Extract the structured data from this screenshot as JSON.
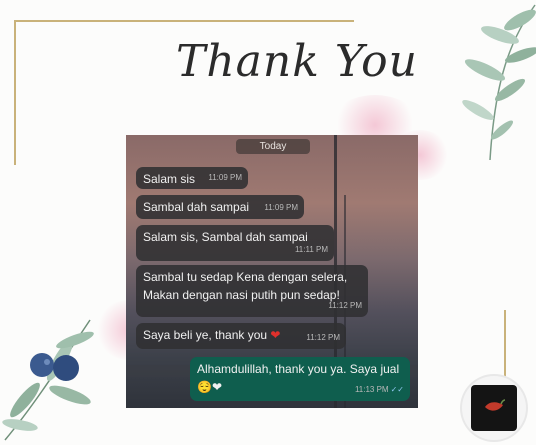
{
  "title": "Thank You",
  "chat": {
    "date_divider": "Today",
    "messages": [
      {
        "text": "Salam sis",
        "time": "11:09 PM",
        "direction": "incoming"
      },
      {
        "text": "Sambal dah sampai",
        "time": "11:09 PM",
        "direction": "incoming"
      },
      {
        "text": "Salam sis, Sambal dah sampai",
        "time": "11:11 PM",
        "direction": "incoming"
      },
      {
        "line1": "Sambal tu sedap Kena dengan selera,",
        "line2": "Makan dengan nasi putih pun sedap!",
        "time": "11:12 PM",
        "direction": "incoming"
      },
      {
        "text": "Saya beli ye, thank you",
        "emoji": "❤",
        "time": "11:12 PM",
        "direction": "incoming"
      },
      {
        "text": "Alhamdulillah, thank you ya. Saya jual",
        "emoji": "😌❤",
        "time": "11:13 PM",
        "direction": "outgoing",
        "status": "✓✓"
      }
    ]
  },
  "colors": {
    "incoming_bubble": "#303032",
    "outgoing_bubble": "#0f5e4e",
    "gold_line": "#c9b27a",
    "heart": "#e0302c"
  },
  "icons": [
    "leaf-branch-icon",
    "blueberry-branch-icon",
    "brand-logo-icon",
    "double-check-icon"
  ]
}
